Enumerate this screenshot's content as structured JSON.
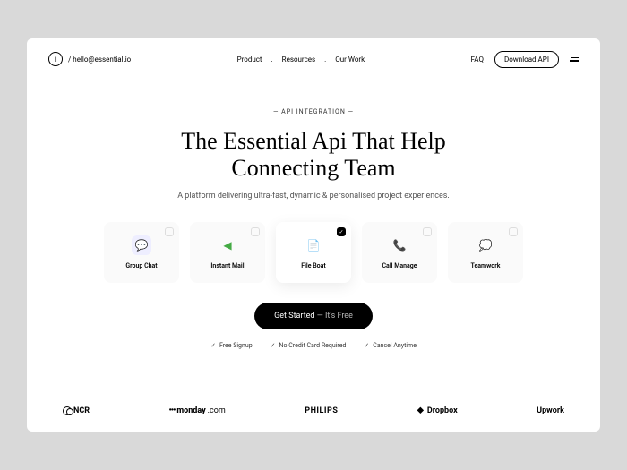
{
  "header": {
    "email": "/ hello@essential.io",
    "nav": [
      "Product",
      "Resources",
      "Our Work"
    ],
    "faq": "FAQ",
    "download": "Download API"
  },
  "hero": {
    "eyebrow": "— API INTEGRATION —",
    "headline_l1": "The Essential Api That Help",
    "headline_l2": "Connecting Team",
    "subhead": "A platform delivering ultra-fast, dynamic & personalised project experiences."
  },
  "cards": [
    {
      "label": "Group Chat",
      "active": false
    },
    {
      "label": "Instant Mail",
      "active": false
    },
    {
      "label": "File Boat",
      "active": true
    },
    {
      "label": "Call Manage",
      "active": false
    },
    {
      "label": "Teamwork",
      "active": false
    }
  ],
  "cta": {
    "main": "Get Started",
    "sub": " — It's Free"
  },
  "benefits": [
    "Free Signup",
    "No Credit Card Required",
    "Cancel Anytime"
  ],
  "logos": {
    "ncr": "NCR",
    "monday": "monday",
    "monday_suffix": ".com",
    "philips": "PHILIPS",
    "dropbox": "Dropbox",
    "upwork": "Upwork"
  }
}
